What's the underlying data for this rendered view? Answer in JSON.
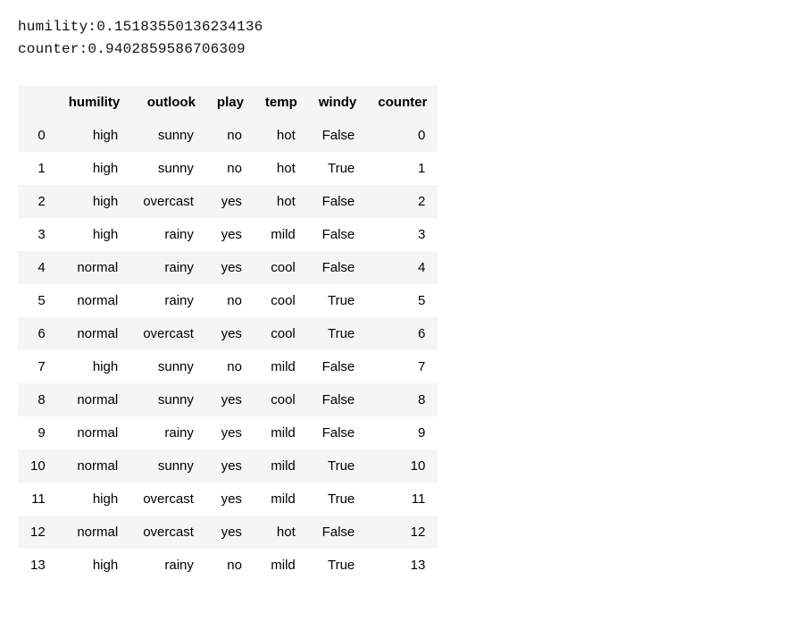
{
  "console": [
    "humility:0.15183550136234136",
    "counter:0.9402859586706309"
  ],
  "table": {
    "columns": [
      "humility",
      "outlook",
      "play",
      "temp",
      "windy",
      "counter"
    ],
    "index": [
      "0",
      "1",
      "2",
      "3",
      "4",
      "5",
      "6",
      "7",
      "8",
      "9",
      "10",
      "11",
      "12",
      "13"
    ],
    "rows": [
      [
        "high",
        "sunny",
        "no",
        "hot",
        "False",
        "0"
      ],
      [
        "high",
        "sunny",
        "no",
        "hot",
        "True",
        "1"
      ],
      [
        "high",
        "overcast",
        "yes",
        "hot",
        "False",
        "2"
      ],
      [
        "high",
        "rainy",
        "yes",
        "mild",
        "False",
        "3"
      ],
      [
        "normal",
        "rainy",
        "yes",
        "cool",
        "False",
        "4"
      ],
      [
        "normal",
        "rainy",
        "no",
        "cool",
        "True",
        "5"
      ],
      [
        "normal",
        "overcast",
        "yes",
        "cool",
        "True",
        "6"
      ],
      [
        "high",
        "sunny",
        "no",
        "mild",
        "False",
        "7"
      ],
      [
        "normal",
        "sunny",
        "yes",
        "cool",
        "False",
        "8"
      ],
      [
        "normal",
        "rainy",
        "yes",
        "mild",
        "False",
        "9"
      ],
      [
        "normal",
        "sunny",
        "yes",
        "mild",
        "True",
        "10"
      ],
      [
        "high",
        "overcast",
        "yes",
        "mild",
        "True",
        "11"
      ],
      [
        "normal",
        "overcast",
        "yes",
        "hot",
        "False",
        "12"
      ],
      [
        "high",
        "rainy",
        "no",
        "mild",
        "True",
        "13"
      ]
    ]
  }
}
